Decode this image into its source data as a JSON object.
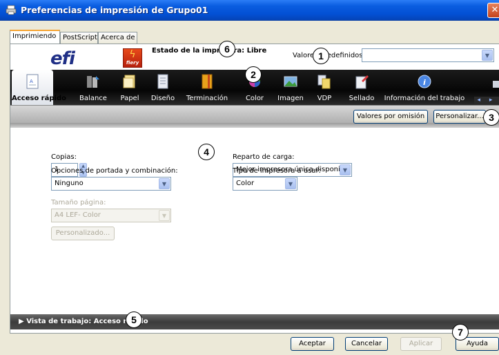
{
  "window": {
    "title": "Preferencias de impresión de Grupo01",
    "close_label": "✕"
  },
  "tabs": [
    {
      "label": "Imprimiendo"
    },
    {
      "label": "PostScript"
    },
    {
      "label": "Acerca de"
    }
  ],
  "header": {
    "logo_text": "efi",
    "fiery_text": "fiery",
    "printer_status": "Estado de la impresora: Libre",
    "presets_label": "Valores predefinidos:",
    "presets_value": ""
  },
  "toolbar": {
    "items": [
      {
        "label": "Acceso rápido",
        "icon": "quick-access-icon"
      },
      {
        "label": "Balance",
        "icon": "balance-icon"
      },
      {
        "label": "Papel",
        "icon": "paper-icon"
      },
      {
        "label": "Diseño",
        "icon": "layout-icon"
      },
      {
        "label": "Terminación",
        "icon": "finishing-icon"
      },
      {
        "label": "Color",
        "icon": "color-icon"
      },
      {
        "label": "Imagen",
        "icon": "image-icon"
      },
      {
        "label": "VDP",
        "icon": "vdp-icon"
      },
      {
        "label": "Sellado",
        "icon": "stamping-icon"
      },
      {
        "label": "Información del trabajo",
        "icon": "info-icon"
      }
    ],
    "scroll": "◂ ▸"
  },
  "actionbar": {
    "defaults_button": "Valores por omisión",
    "customize_button": "Personalizar..."
  },
  "form": {
    "copies_label": "Copias:",
    "copies_value": "1",
    "cover_label": "Opciones de portada y combinación:",
    "cover_value": "Ninguno",
    "page_size_label": "Tamaño página:",
    "page_size_value": "A4 LEF- Color",
    "custom_button": "Personalizado...",
    "load_balance_label": "Reparto de carga:",
    "load_balance_value": "Mejor impresora única disponible",
    "printer_type_label": "Tipo de impresora a usar:",
    "printer_type_value": "Color"
  },
  "job_view": {
    "label": "Vista de trabajo: Acceso rápido",
    "arrow": "▶"
  },
  "footer": {
    "ok": "Aceptar",
    "cancel": "Cancelar",
    "apply": "Aplicar",
    "help": "Ayuda"
  },
  "callouts": [
    "1",
    "2",
    "3",
    "4",
    "5",
    "6",
    "7"
  ],
  "colors": {
    "titlebar": "#0a5de0",
    "toolbar": "#0a0a0a",
    "greybar": "#b9b9b9",
    "tab_accent": "#f5a331"
  }
}
